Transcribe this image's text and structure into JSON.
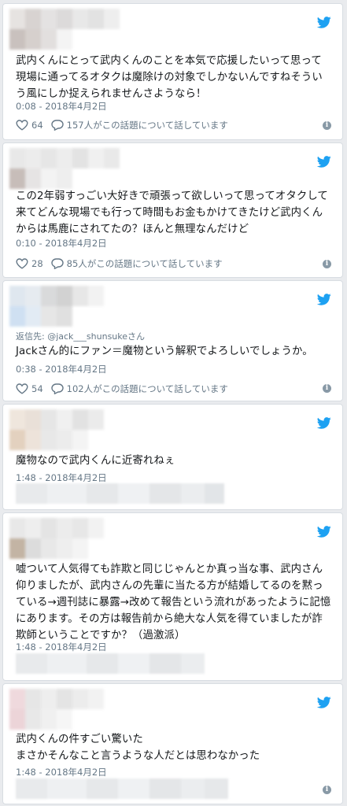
{
  "tweets": [
    {
      "text": "武内くんにとって武内くんのことを本気で応援したいって思って現場に通ってるオタクは魔除けの対象でしかないんですねそういう風にしか捉えられませんさようなら！",
      "timestamp": "0:08 - 2018年4月2日",
      "likes": "64",
      "conversation": "157人がこの話題について話しています"
    },
    {
      "text": "この2年弱すっごい大好きで頑張って欲しいって思ってオタクして来てどんな現場でも行って時間もお金もかけてきたけど武内くんからは馬鹿にされてたの？ほんと無理なんだけど",
      "timestamp": "0:10 - 2018年4月2日",
      "likes": "28",
      "conversation": "85人がこの話題について話しています"
    },
    {
      "reply_label": "返信先: ",
      "reply_handle": "@jack___shunsukeさん",
      "text": "Jackさん的にファン＝魔物という解釈でよろしいでしょうか。",
      "timestamp": "0:38 - 2018年4月2日",
      "likes": "54",
      "conversation": "102人がこの話題について話しています"
    },
    {
      "text": "魔物なので武内くんに近寄れねぇ",
      "timestamp": "1:48 - 2018年4月2日"
    },
    {
      "text": "嘘ついて人気得ても詐欺と同じじゃんとか真っ当な事、武内さん仰りましたが、武内さんの先輩に当たる方が結婚してるのを黙っている→週刊誌に暴露→改めて報告という流れがあったように記憶にあります。その方は報告前から絶大な人気を得ていましたが詐欺師ということですか？（過激派）",
      "timestamp": "1:48 - 2018年4月2日"
    },
    {
      "text": "武内くんの件すごい驚いた\nまさかそんなこと言うような人だとは思わなかった",
      "timestamp": "1:48 - 2018年4月2日"
    }
  ],
  "colors": {
    "twitter_blue": "#1da1f2",
    "meta_gray": "#657786",
    "info_gray": "#8899a6"
  },
  "icons": {
    "bird": "twitter-bird-icon",
    "like": "heart-icon",
    "conversation": "speech-bubble-icon",
    "info": "info-icon"
  }
}
